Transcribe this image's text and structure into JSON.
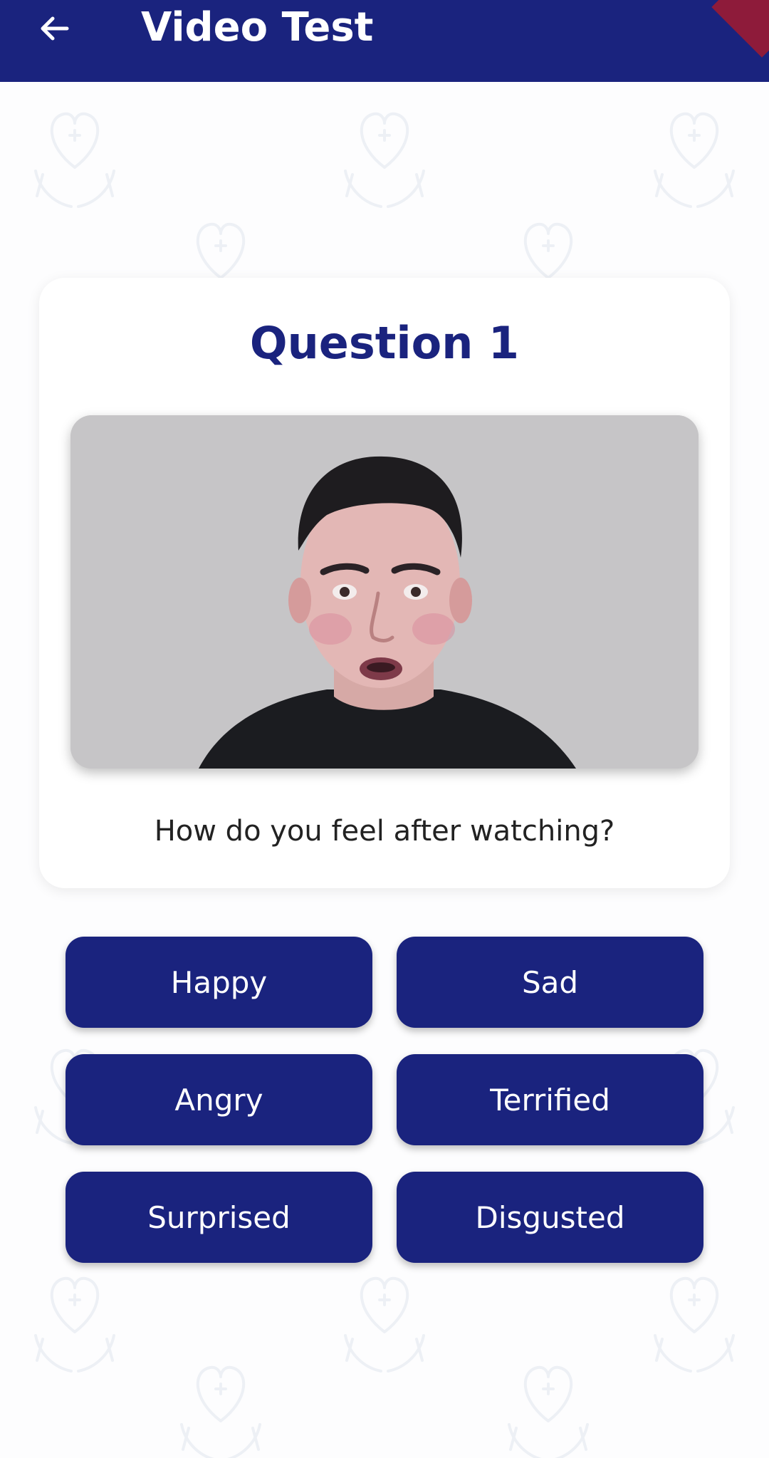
{
  "app_bar": {
    "title": "Video Test",
    "back_icon": "arrow-left-icon",
    "background_color": "#1a237e"
  },
  "card": {
    "question_title": "Question 1",
    "prompt": "How do you feel after watching?",
    "title_color": "#1a237e"
  },
  "video": {
    "content": "video-frame-person"
  },
  "options": [
    {
      "label": "Happy"
    },
    {
      "label": "Sad"
    },
    {
      "label": "Angry"
    },
    {
      "label": "Terrified"
    },
    {
      "label": "Surprised"
    },
    {
      "label": "Disgusted"
    }
  ],
  "colors": {
    "accent": "#1a237e",
    "button_text": "#ffffff",
    "ribbon": "#8e1b3a"
  },
  "background_pattern_icon": "heart-hands-icon"
}
